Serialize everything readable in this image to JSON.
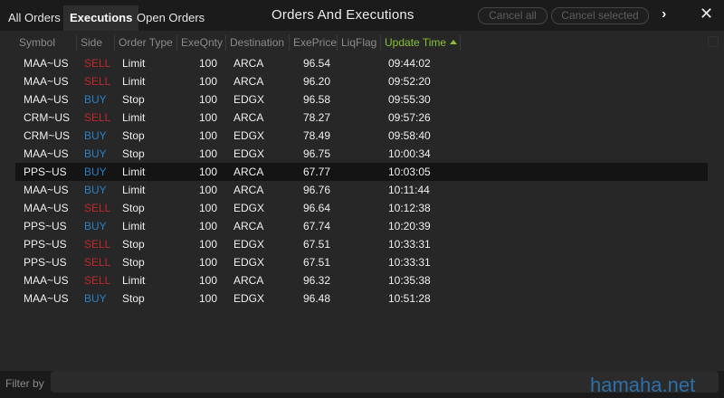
{
  "tabs": [
    {
      "label": "All Orders"
    },
    {
      "label": "Executions"
    },
    {
      "label": "Open Orders"
    }
  ],
  "window": {
    "title": "Orders And Executions"
  },
  "toolbar": {
    "cancel_all_label": "Cancel all",
    "cancel_selected_label": "Cancel selected",
    "chevron_glyph": "›",
    "close_glyph": "✕"
  },
  "columns": [
    "Symbol",
    "Side",
    "Order Type",
    "ExeQnty",
    "Destination",
    "ExePrice",
    "LiqFlag",
    "Update Time"
  ],
  "sorted_column": "Update Time",
  "sort_direction": "ascending",
  "colors": {
    "sell": "#c0262c",
    "buy": "#2a7fc0",
    "sorted_header": "#86c232"
  },
  "rows": [
    {
      "symbol": "MAA~US",
      "side": "SELL",
      "type": "Limit",
      "qty": "100",
      "dest": "ARCA",
      "price": "96.54",
      "liq": "",
      "time": "09:44:02"
    },
    {
      "symbol": "MAA~US",
      "side": "SELL",
      "type": "Limit",
      "qty": "100",
      "dest": "ARCA",
      "price": "96.20",
      "liq": "",
      "time": "09:52:20"
    },
    {
      "symbol": "MAA~US",
      "side": "BUY",
      "type": "Stop",
      "qty": "100",
      "dest": "EDGX",
      "price": "96.58",
      "liq": "",
      "time": "09:55:30"
    },
    {
      "symbol": "CRM~US",
      "side": "SELL",
      "type": "Limit",
      "qty": "100",
      "dest": "ARCA",
      "price": "78.27",
      "liq": "",
      "time": "09:57:26"
    },
    {
      "symbol": "CRM~US",
      "side": "BUY",
      "type": "Stop",
      "qty": "100",
      "dest": "EDGX",
      "price": "78.49",
      "liq": "",
      "time": "09:58:40"
    },
    {
      "symbol": "MAA~US",
      "side": "BUY",
      "type": "Stop",
      "qty": "100",
      "dest": "EDGX",
      "price": "96.75",
      "liq": "",
      "time": "10:00:34"
    },
    {
      "symbol": "PPS~US",
      "side": "BUY",
      "type": "Limit",
      "qty": "100",
      "dest": "ARCA",
      "price": "67.77",
      "liq": "",
      "time": "10:03:05",
      "selected": true
    },
    {
      "symbol": "MAA~US",
      "side": "BUY",
      "type": "Limit",
      "qty": "100",
      "dest": "ARCA",
      "price": "96.76",
      "liq": "",
      "time": "10:11:44"
    },
    {
      "symbol": "MAA~US",
      "side": "SELL",
      "type": "Stop",
      "qty": "100",
      "dest": "EDGX",
      "price": "96.64",
      "liq": "",
      "time": "10:12:38"
    },
    {
      "symbol": "PPS~US",
      "side": "BUY",
      "type": "Limit",
      "qty": "100",
      "dest": "ARCA",
      "price": "67.74",
      "liq": "",
      "time": "10:20:39"
    },
    {
      "symbol": "PPS~US",
      "side": "SELL",
      "type": "Stop",
      "qty": "100",
      "dest": "EDGX",
      "price": "67.51",
      "liq": "",
      "time": "10:33:31"
    },
    {
      "symbol": "PPS~US",
      "side": "SELL",
      "type": "Stop",
      "qty": "100",
      "dest": "EDGX",
      "price": "67.51",
      "liq": "",
      "time": "10:33:31"
    },
    {
      "symbol": "MAA~US",
      "side": "SELL",
      "type": "Limit",
      "qty": "100",
      "dest": "ARCA",
      "price": "96.32",
      "liq": "",
      "time": "10:35:38"
    },
    {
      "symbol": "MAA~US",
      "side": "BUY",
      "type": "Stop",
      "qty": "100",
      "dest": "EDGX",
      "price": "96.48",
      "liq": "",
      "time": "10:51:28"
    }
  ],
  "filter": {
    "label": "Filter by",
    "value": "",
    "placeholder": ""
  },
  "watermark": "hamaha.net"
}
